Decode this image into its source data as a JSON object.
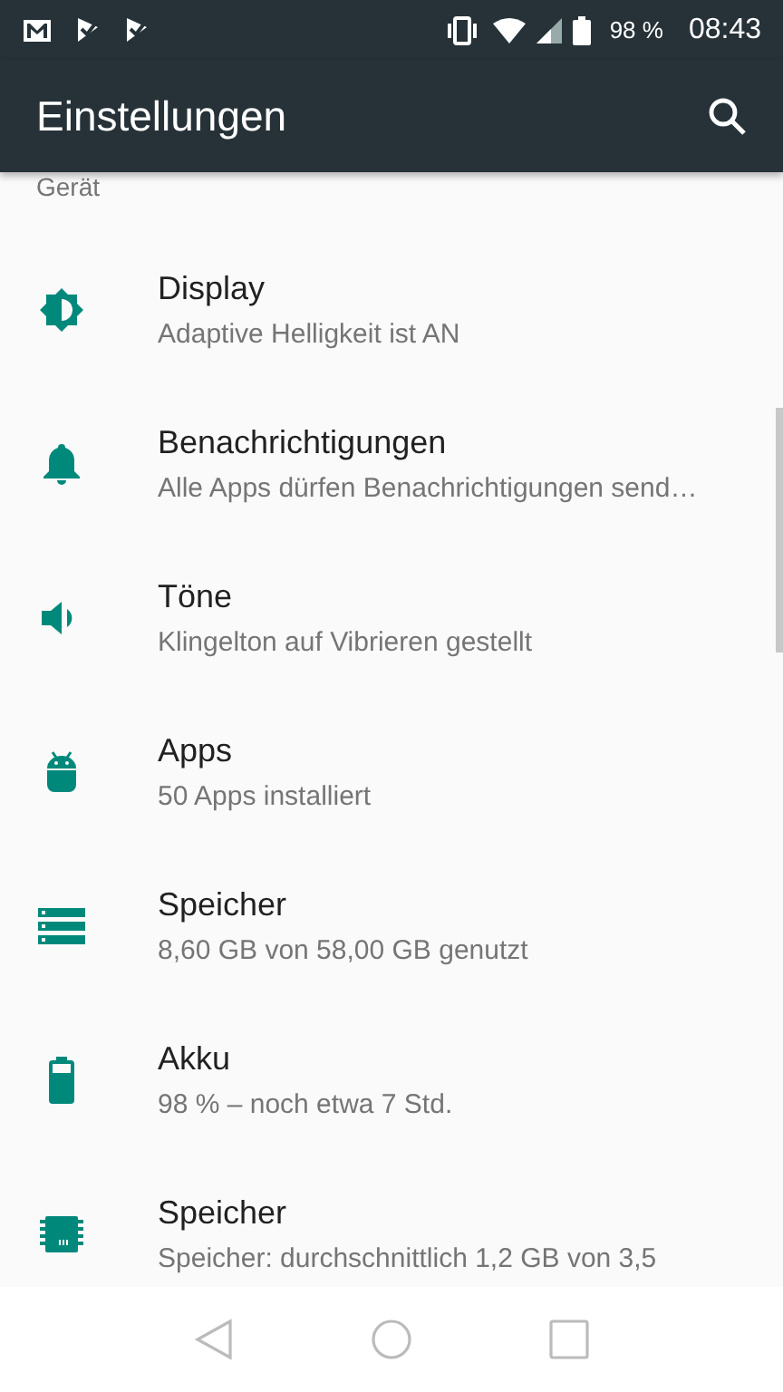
{
  "status_bar": {
    "battery_text": "98 %",
    "time": "08:43"
  },
  "toolbar": {
    "title": "Einstellungen"
  },
  "section": {
    "title": "Gerät"
  },
  "items": [
    {
      "kind": "display",
      "title": "Display",
      "subtitle": "Adaptive Helligkeit ist AN"
    },
    {
      "kind": "notifications",
      "title": "Benachrichtigungen",
      "subtitle": "Alle Apps dürfen Benachrichtigungen send…"
    },
    {
      "kind": "sound",
      "title": "Töne",
      "subtitle": "Klingelton auf Vibrieren gestellt"
    },
    {
      "kind": "apps",
      "title": "Apps",
      "subtitle": "50 Apps installiert"
    },
    {
      "kind": "storage",
      "title": "Speicher",
      "subtitle": "8,60  GB von 58,00  GB genutzt"
    },
    {
      "kind": "battery",
      "title": "Akku",
      "subtitle": "98 % – noch etwa 7 Std."
    },
    {
      "kind": "memory",
      "title": "Speicher",
      "subtitle": "Speicher: durchschnittlich 1,2  GB von 3,5"
    }
  ]
}
